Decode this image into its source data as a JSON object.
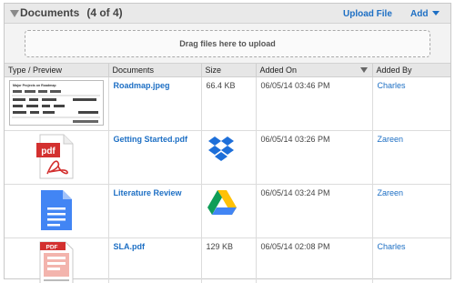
{
  "header": {
    "title": "Documents",
    "count": "(4 of 4)",
    "upload_label": "Upload File",
    "add_label": "Add"
  },
  "dropzone": {
    "text": "Drag files here to upload"
  },
  "table": {
    "columns": [
      "Type / Preview",
      "Documents",
      "Size",
      "Added On",
      "Added By"
    ],
    "sort_column": "Added On",
    "rows": [
      {
        "preview": "image-thumbnail",
        "name": "Roadmap.jpeg",
        "size": "66.4 KB",
        "size_icon": null,
        "added_on": "06/05/14 03:46 PM",
        "added_by": "Charles"
      },
      {
        "preview": "pdf-icon",
        "name": "Getting Started.pdf",
        "size": "",
        "size_icon": "dropbox-icon",
        "added_on": "06/05/14 03:26 PM",
        "added_by": "Zareen"
      },
      {
        "preview": "google-doc-icon",
        "name": "Literature Review",
        "size": "",
        "size_icon": "google-drive-icon",
        "added_on": "06/05/14 03:24 PM",
        "added_by": "Zareen"
      },
      {
        "preview": "pdf-thumbnail",
        "name": "SLA.pdf",
        "size": "129 KB",
        "size_icon": null,
        "added_on": "06/05/14 02:08 PM",
        "added_by": "Charles"
      }
    ]
  },
  "thumbnails": {
    "roadmap_heading": "Major Projects on Roadmap",
    "pdf_badge": "PDF",
    "pdf_word": "pdf"
  },
  "colors": {
    "link": "#1d6fc4",
    "header_bg": "#e9e9e9",
    "dropbox": "#1e6fd9",
    "google_doc": "#4285f4",
    "pdf_red": "#d3302f"
  }
}
